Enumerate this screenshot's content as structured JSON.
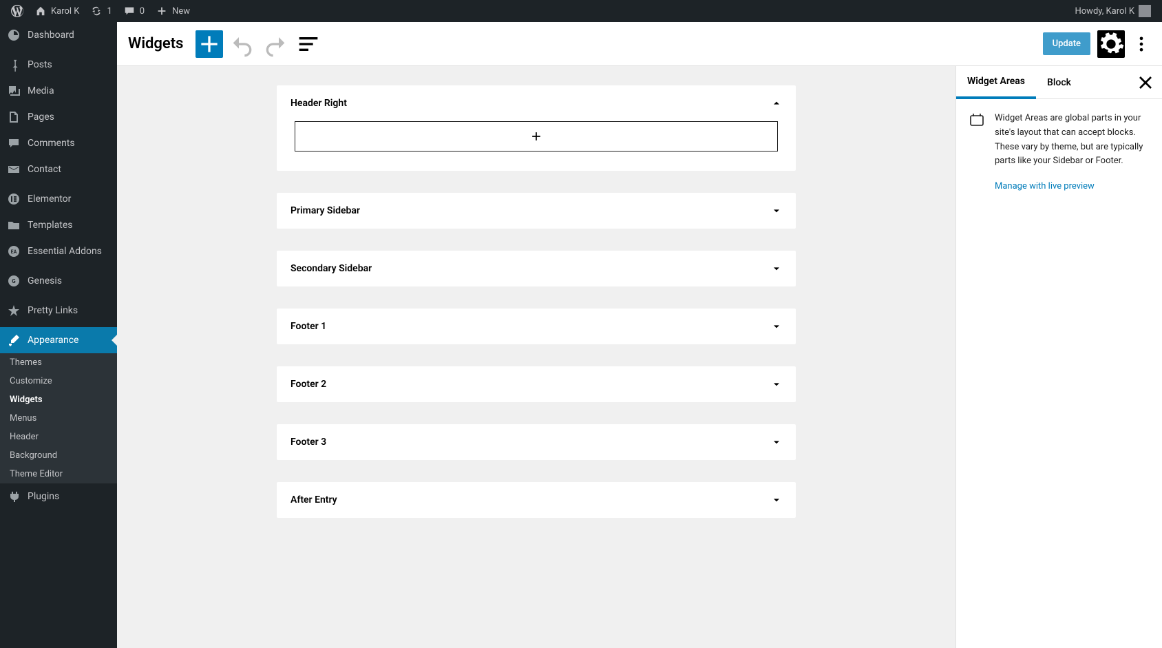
{
  "adminbar": {
    "site_name": "Karol K",
    "updates_count": "1",
    "comments_count": "0",
    "new_label": "New",
    "greeting": "Howdy, Karol K"
  },
  "sidebar": {
    "items": [
      {
        "label": "Dashboard",
        "icon": "dashboard"
      },
      {
        "label": "Posts",
        "icon": "pin"
      },
      {
        "label": "Media",
        "icon": "media"
      },
      {
        "label": "Pages",
        "icon": "pages"
      },
      {
        "label": "Comments",
        "icon": "comments"
      },
      {
        "label": "Contact",
        "icon": "mail"
      },
      {
        "label": "Elementor",
        "icon": "elementor"
      },
      {
        "label": "Templates",
        "icon": "folder"
      },
      {
        "label": "Essential Addons",
        "icon": "ea"
      },
      {
        "label": "Genesis",
        "icon": "genesis"
      },
      {
        "label": "Pretty Links",
        "icon": "star"
      },
      {
        "label": "Appearance",
        "icon": "brush"
      },
      {
        "label": "Plugins",
        "icon": "plug"
      }
    ],
    "submenu": [
      {
        "label": "Themes"
      },
      {
        "label": "Customize"
      },
      {
        "label": "Widgets"
      },
      {
        "label": "Menus"
      },
      {
        "label": "Header"
      },
      {
        "label": "Background"
      },
      {
        "label": "Theme Editor"
      }
    ]
  },
  "header": {
    "title": "Widgets",
    "update_label": "Update"
  },
  "widget_areas": [
    {
      "title": "Header Right",
      "expanded": true
    },
    {
      "title": "Primary Sidebar",
      "expanded": false
    },
    {
      "title": "Secondary Sidebar",
      "expanded": false
    },
    {
      "title": "Footer 1",
      "expanded": false
    },
    {
      "title": "Footer 2",
      "expanded": false
    },
    {
      "title": "Footer 3",
      "expanded": false
    },
    {
      "title": "After Entry",
      "expanded": false
    }
  ],
  "right_panel": {
    "tabs": [
      {
        "label": "Widget Areas",
        "active": true
      },
      {
        "label": "Block",
        "active": false
      }
    ],
    "description": "Widget Areas are global parts in your site's layout that can accept blocks. These vary by theme, but are typically parts like your Sidebar or Footer.",
    "link_label": "Manage with live preview"
  }
}
